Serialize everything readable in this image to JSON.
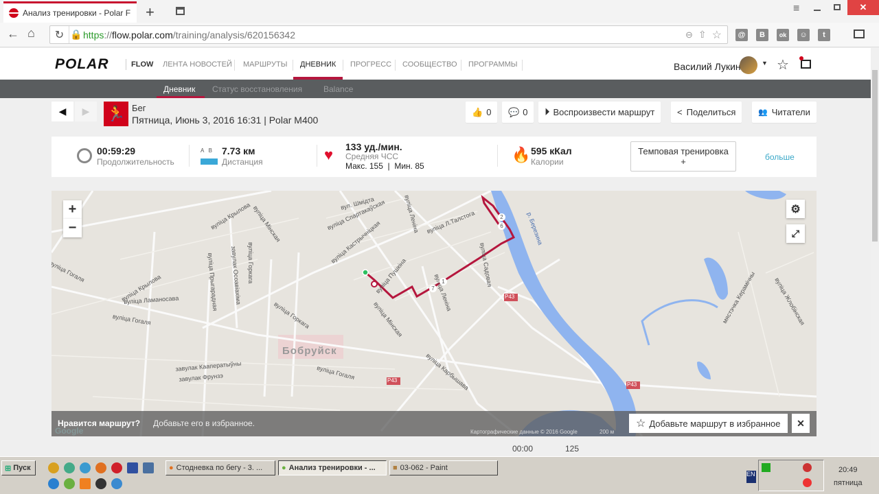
{
  "browser": {
    "tab_title": "Анализ тренировки - Polar F",
    "url_scheme": "https",
    "url_host": "flow.polar.com",
    "url_path": "/training/analysis/620156342",
    "extensions": [
      "@",
      "В",
      "ok",
      "☺",
      "t"
    ]
  },
  "header": {
    "logo": "POLAR",
    "flow": "FLOW",
    "nav": [
      "ЛЕНТА НОВОСТЕЙ",
      "МАРШРУТЫ",
      "ДНЕВНИК",
      "ПРОГРЕСС",
      "СООБЩЕСТВО",
      "ПРОГРАММЫ"
    ],
    "active_nav": "ДНЕВНИК",
    "user_name": "Василий Лукин"
  },
  "subnav": [
    "Дневник",
    "Статус восстановления",
    "Balance"
  ],
  "training": {
    "sport": "Бег",
    "datetime": "Пятница, Июнь 3, 2016 16:31 | Polar M400",
    "likes": "0",
    "comments": "0",
    "play_route": "Воспроизвести маршрут",
    "share": "Поделиться",
    "followers": "Читатели"
  },
  "stats": {
    "duration": "00:59:29",
    "duration_label": "Продолжительность",
    "ab": "A   B",
    "distance": "7.73 км",
    "distance_label": "Дистанция",
    "hr": "133 уд./мин.",
    "hr_label": "Средняя ЧСС",
    "hr_range": "Макс. 155  |  Мин. 85",
    "calories": "595 кКал",
    "calories_label": "Калории",
    "training_type": "Темповая тренировка",
    "training_plus": "+",
    "more": "больше"
  },
  "map": {
    "zoom_in": "+",
    "zoom_out": "−",
    "city": "Бобруйск",
    "river": "р. Березина",
    "road": "P43",
    "labels": [
      "вуліца Мінская",
      "вуліца Мінская",
      "вуліца Крылова",
      "вуліца Крылова",
      "вуліца Гогаля",
      "вуліца Гогаля",
      "вуліца Гогаля",
      "вуліца Ламаносава",
      "вуліца Горкага",
      "вуліца Горкага",
      "вуліца Пушкіна",
      "вуліца Кастрычніцкая",
      "вуліца Спартакаўская",
      "вуліца Леніна",
      "вуліца Леніна",
      "вуліца Л.Талстога",
      "вуліца Садовая",
      "вуліца Карбышава",
      "вул. Шмідта",
      "завулак Кааператыўны",
      "завулак Фрунзэ",
      "вуліца Прыгарадная",
      "завулак Осоавіахіма",
      "мястэчка Керамічны",
      "вуліца Жлобінская"
    ],
    "markers": [
      "1",
      "2",
      "6",
      "7"
    ],
    "like_q": "Нравится маршрут?",
    "like_hint": "Добавьте его в избранное.",
    "fav_button": "Добавьте маршрут в избранное",
    "close": "✕",
    "attribution": "Картографические данные © 2016 Google",
    "scale": "200 м",
    "google": "Google",
    "colors": {
      "route": "#b5163d",
      "water": "#8fb4ef"
    }
  },
  "below": {
    "time": "00:00",
    "value": "125"
  },
  "taskbar": {
    "start": "Пуск",
    "windows": [
      "Стодневка по бегу - 3. ...",
      "Анализ тренировки - ...",
      "03-062 - Paint"
    ],
    "lang": "EN",
    "time": "20:49",
    "day": "пятница"
  }
}
